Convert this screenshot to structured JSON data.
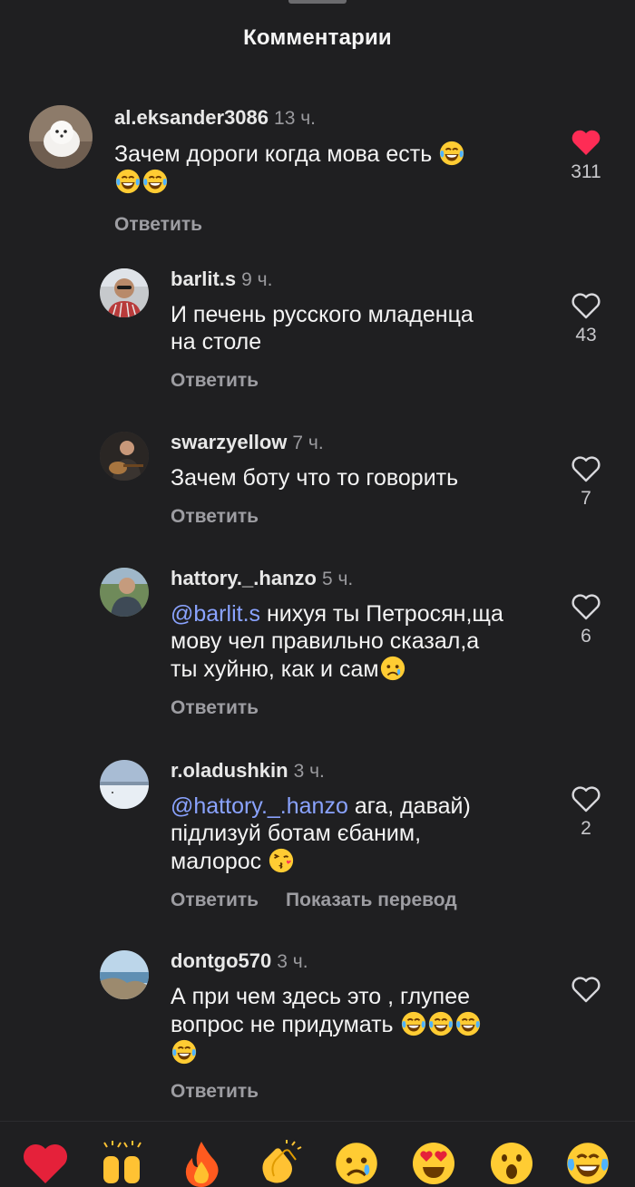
{
  "header": {
    "title": "Комментарии"
  },
  "comments": [
    {
      "username": "al.eksander3086",
      "time": "13 ч.",
      "text": "Зачем дороги когда мова есть",
      "emoji_suffix": [
        "joy"
      ],
      "second_line_emojis": [
        "joy",
        "joy"
      ],
      "reply_label": "Ответить",
      "likes": "311",
      "liked": true,
      "avatar_icon": "white-dog-avatar"
    },
    {
      "username": "barlit.s",
      "time": "9 ч.",
      "text_lines": [
        "И печень русского младенца",
        "на столе"
      ],
      "reply_label": "Ответить",
      "likes": "43",
      "liked": false,
      "avatar_icon": "man-sunglasses-avatar"
    },
    {
      "username": "swarzyellow",
      "time": "7 ч.",
      "text_lines": [
        "Зачем боту что то говорить"
      ],
      "reply_label": "Ответить",
      "likes": "7",
      "liked": false,
      "avatar_icon": "man-with-guitar-avatar"
    },
    {
      "username": "hattory._.hanzo",
      "time": "5 ч.",
      "mention": "@barlit.s",
      "text_lines": [
        " нихуя ты Петросян,ща",
        "мову чел правильно сказал,а",
        "ты хуйню, как и сам"
      ],
      "reply_label": "Ответить",
      "likes": "6",
      "liked": false,
      "avatar_icon": "man-outdoors-avatar"
    },
    {
      "username": "r.oladushkin",
      "time": "3 ч.",
      "mention": "@hattory._.hanzo",
      "text_lines": [
        " ага, давай)",
        "підлизуй ботам єбаним,",
        "малорос"
      ],
      "reply_label": "Ответить",
      "translate_label": "Показать перевод",
      "likes": "2",
      "liked": false,
      "avatar_icon": "snow-field-avatar"
    },
    {
      "username": "dontgo570",
      "time": "3 ч.",
      "text_lines": [
        "А при чем здесь это , глупее",
        "вопрос не придумать"
      ],
      "reply_label": "Ответить",
      "likes": "",
      "liked": false,
      "avatar_icon": "seaside-cliff-avatar"
    }
  ],
  "emoji_bar": {
    "emojis": [
      "red-heart",
      "raising-hands",
      "fire",
      "clapping-hands",
      "crying-face",
      "heart-eyes",
      "astonished-face",
      "joy-face"
    ]
  },
  "colors": {
    "background": "#1f1f21",
    "like_active": "#fe2c55",
    "mention": "#8aa3ff",
    "secondary_text": "#9d9da2"
  }
}
